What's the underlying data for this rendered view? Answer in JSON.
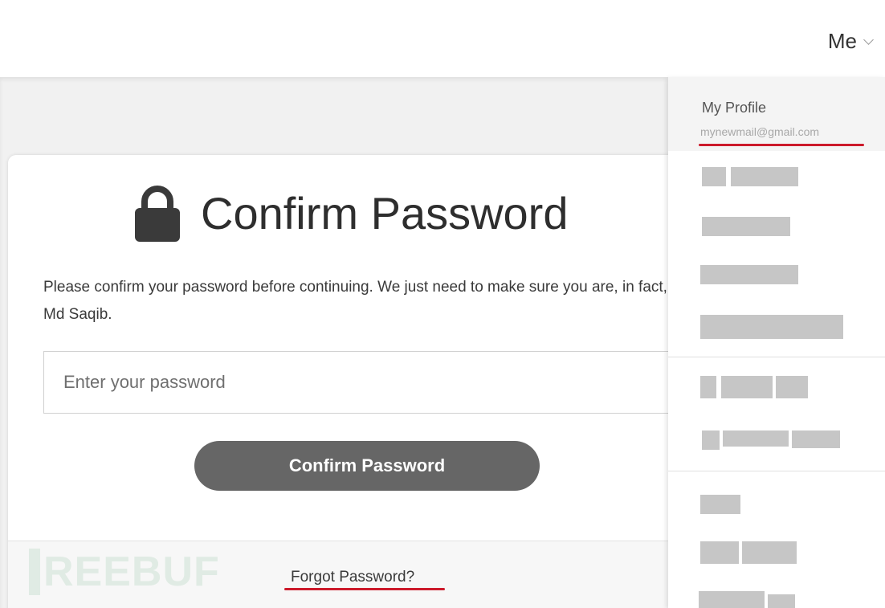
{
  "header": {
    "me_label": "Me"
  },
  "card": {
    "title": "Confirm Password",
    "description": "Please confirm your password before continuing. We just need to make sure you are, in fact, Md Saqib.",
    "password_input": {
      "placeholder": "Enter your password",
      "value": ""
    },
    "confirm_button_label": "Confirm Password",
    "forgot_link_label": "Forgot Password?",
    "watermark_text": "REEBUF"
  },
  "dropdown": {
    "profile_label": "My Profile",
    "profile_email": "mynewmail@gmail.com"
  },
  "colors": {
    "button_bg": "#666666",
    "highlight_underline": "#cc1a2b",
    "redaction": "#c6c6c6"
  }
}
